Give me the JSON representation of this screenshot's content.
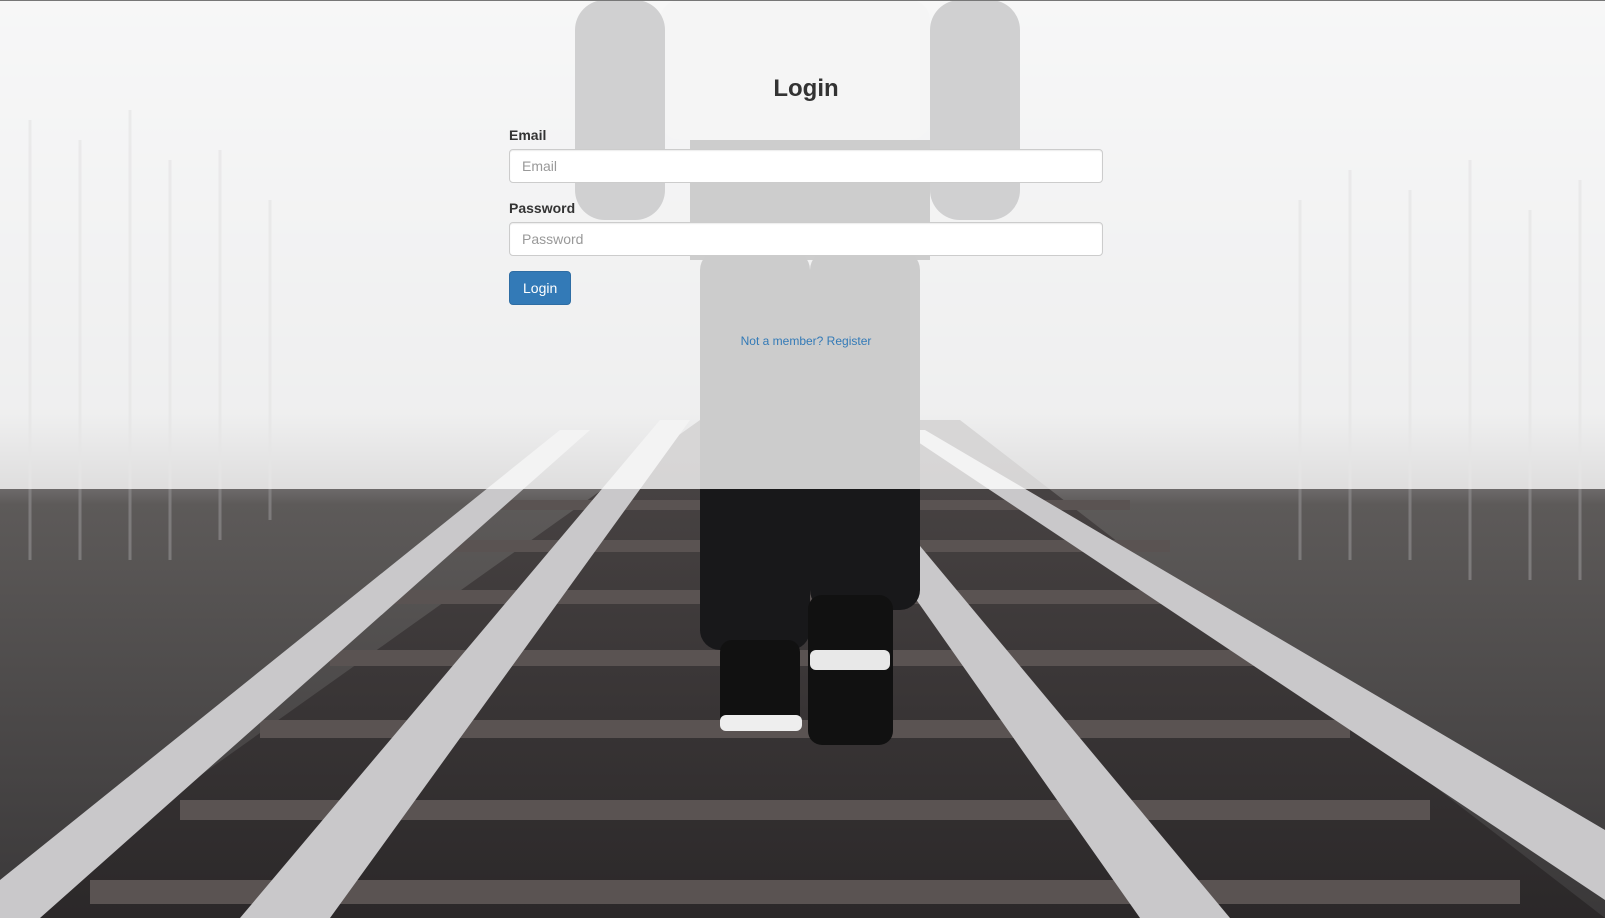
{
  "login_form": {
    "title": "Login",
    "email_label": "Email",
    "email_placeholder": "Email",
    "email_value": "",
    "password_label": "Password",
    "password_placeholder": "Password",
    "password_value": "",
    "submit_label": "Login",
    "register_prompt": "Not a member? Register"
  },
  "colors": {
    "primary_button": "#337ab7",
    "link": "#337ab7",
    "overlay": "rgba(255,255,255,0.78)"
  },
  "background": {
    "subject": "person-walking-on-railway-tracks-photo"
  }
}
